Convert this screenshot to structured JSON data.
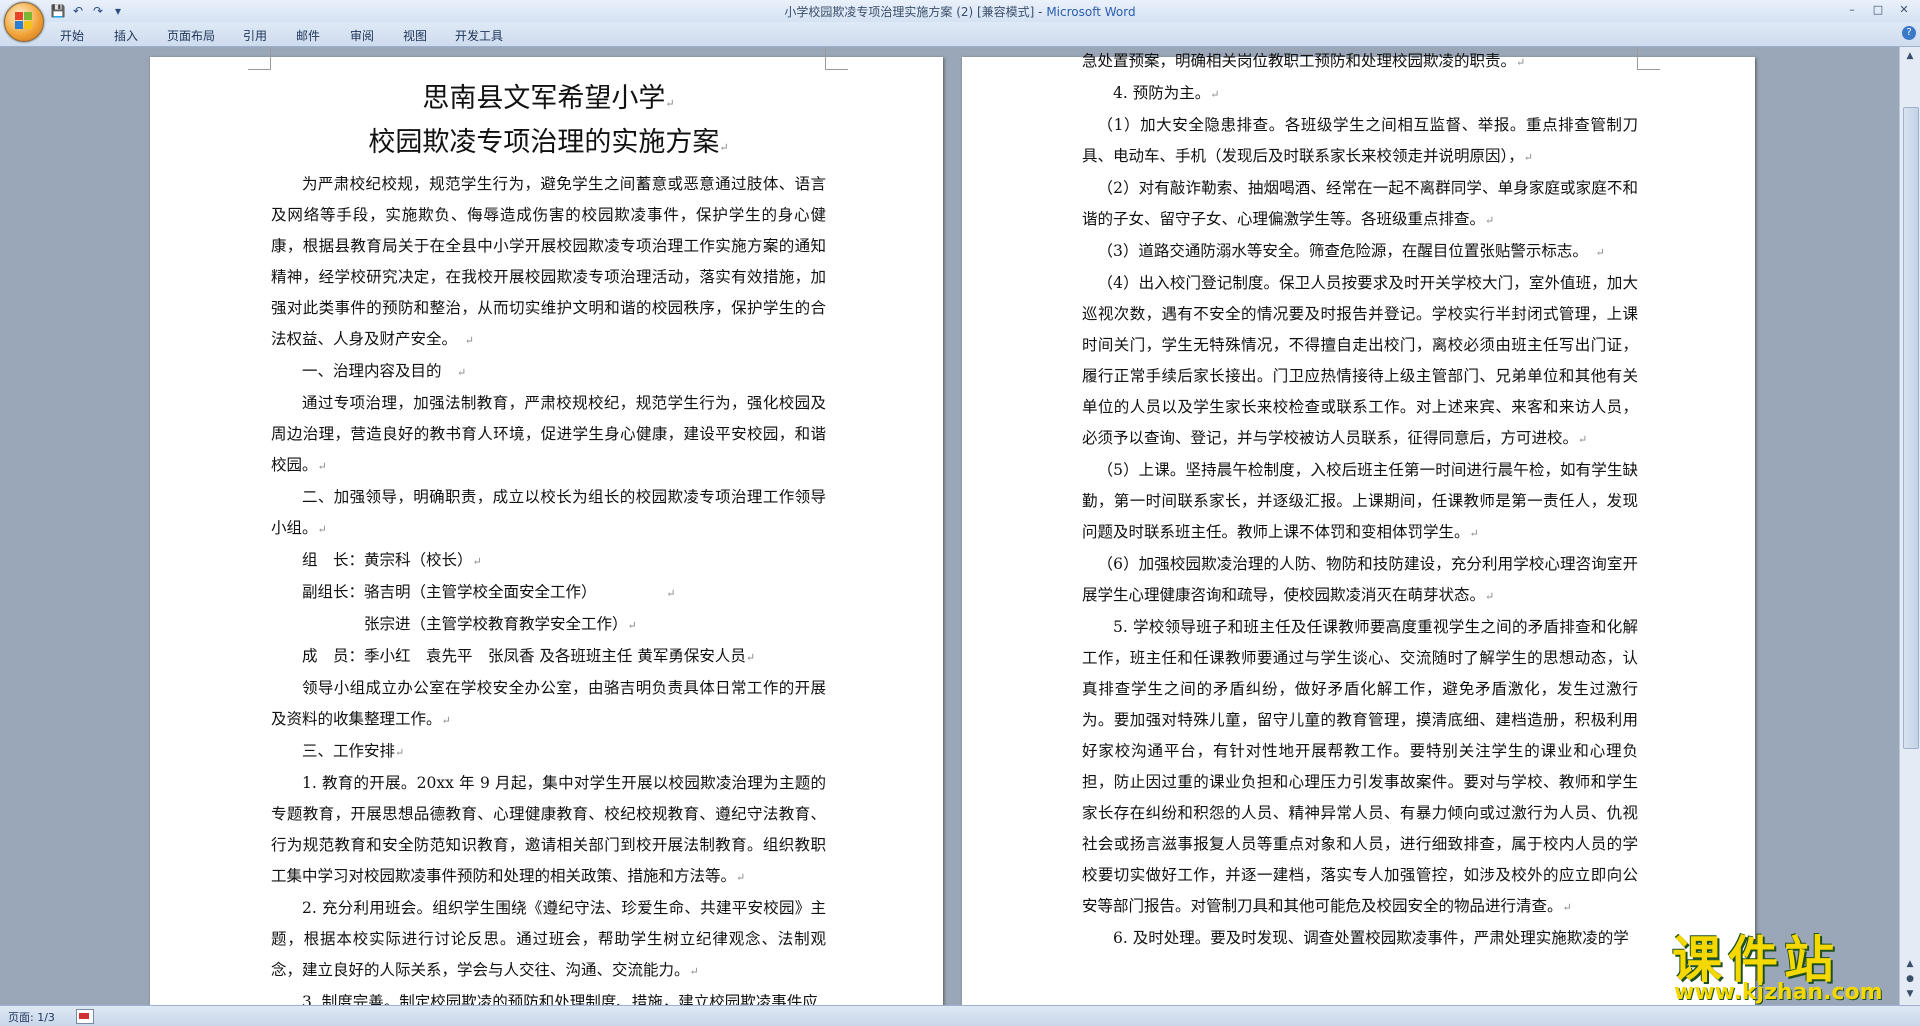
{
  "window": {
    "title": "小学校园欺凌专项治理实施方案 (2) [兼容模式] - ",
    "app": "Microsoft Word",
    "controls": [
      "–",
      "□",
      "✕"
    ]
  },
  "qat": {
    "save": "💾",
    "undo": "↶",
    "redo": "↷",
    "more": "▾"
  },
  "ribbon": {
    "tabs": [
      "开始",
      "插入",
      "页面布局",
      "引用",
      "邮件",
      "审阅",
      "视图",
      "开发工具"
    ],
    "help": "?"
  },
  "doc": {
    "page1": {
      "title1": "思南县文军希望小学",
      "title2": "校园欺凌专项治理的实施方案",
      "para1": "为严肃校纪校规，规范学生行为，避免学生之间蓄意或恶意通过肢体、语言及网络等手段，实施欺负、侮辱造成伤害的校园欺凌事件，保护学生的身心健康，根据县教育局关于在全县中小学开展校园欺凌专项治理工作实施方案的通知精神，经学校研究决定，在我校开展校园欺凌专项治理活动，落实有效措施，加强对此类事件的预防和整治，从而切实维护文明和谐的校园秩序，保护学生的合法权益、人身及财产安全。",
      "h1": "一、治理内容及目的",
      "para2": "通过专项治理，加强法制教育，严肃校规校纪，规范学生行为，强化校园及周边治理，营造良好的教书育人环境，促进学生身心健康，建设平安校园，和谐校园。",
      "h2": "二、加强领导，明确职责，成立以校长为组长的校园欺凌专项治理工作领导小组。",
      "leader": "组　长：黄宗科（校长）",
      "deputy1": "副组长：骆吉明（主管学校全面安全工作）",
      "deputy2": "张宗进（主管学校教育教学安全工作）",
      "members": "成　员：季小红　袁先平　张凤香 及各班班主任 黄军勇保安人员",
      "office": "领导小组成立办公室在学校安全办公室，由骆吉明负责具体日常工作的开展及资料的收集整理工作。",
      "h3": "三、工作安排",
      "item1": "1. 教育的开展。20xx 年 9 月起，集中对学生开展以校园欺凌治理为主题的专题教育，开展思想品德教育、心理健康教育、校纪校规教育、遵纪守法教育、行为规范教育和安全防范知识教育，邀请相关部门到校开展法制教育。组织教职工集中学习对校园欺凌事件预防和处理的相关政策、措施和方法等。",
      "item2": "2. 充分利用班会。组织学生围绕《遵纪守法、珍爱生命、共建平安校园》主题，根据本校实际进行讨论反思。通过班会，帮助学生树立纪律观念、法制观念，建立良好的人际关系，学会与人交往、沟通、交流能力。",
      "item3": "3. 制度完善。制定校园欺凌的预防和处理制度、措施，建立校园欺凌事件应"
    },
    "page2": {
      "cont": "急处置预案，明确相关岗位教职工预防和处理校园欺凌的职责。",
      "item4": "4. 预防为主。",
      "s1": "（1）加大安全隐患排查。各班级学生之间相互监督、举报。重点排查管制刀具、电动车、手机（发现后及时联系家长来校领走并说明原因），",
      "s2": "（2）对有敲诈勒索、抽烟喝酒、经常在一起不离群同学、单身家庭或家庭不和谐的子女、留守子女、心理偏激学生等。各班级重点排查。",
      "s3": "（3）道路交通防溺水等安全。筛查危险源，在醒目位置张贴警示标志。",
      "s4": "（4）出入校门登记制度。保卫人员按要求及时开关学校大门，室外值班，加大巡视次数，遇有不安全的情况要及时报告并登记。学校实行半封闭式管理，上课时间关门，学生无特殊情况，不得擅自走出校门，离校必须由班主任写出门证，履行正常手续后家长接出。门卫应热情接待上级主管部门、兄弟单位和其他有关单位的人员以及学生家长来校检查或联系工作。对上述来宾、来客和来访人员，必须予以查询、登记，并与学校被访人员联系，征得同意后，方可进校。",
      "s5": "（5）上课。坚持晨午检制度，入校后班主任第一时间进行晨午检，如有学生缺勤，第一时间联系家长，并逐级汇报。上课期间，任课教师是第一责任人，发现问题及时联系班主任。教师上课不体罚和变相体罚学生。",
      "s6": "（6）加强校园欺凌治理的人防、物防和技防建设，充分利用学校心理咨询室开展学生心理健康咨询和疏导，使校园欺凌消灭在萌芽状态。",
      "item5": "5. 学校领导班子和班主任及任课教师要高度重视学生之间的矛盾排查和化解工作，班主任和任课教师要通过与学生谈心、交流随时了解学生的思想动态，认真排查学生之间的矛盾纠纷，做好矛盾化解工作，避免矛盾激化，发生过激行为。要加强对特殊儿童，留守儿童的教育管理，摸清底细、建档造册，积极利用好家校沟通平台，有针对性地开展帮教工作。要特别关注学生的课业和心理负担，防止因过重的课业负担和心理压力引发事故案件。要对与学校、教师和学生家长存在纠纷和积怨的人员、精神异常人员、有暴力倾向或过激行为人员、仇视社会或扬言滋事报复人员等重点对象和人员，进行细致排查，属于校内人员的学校要切实做好工作，并逐一建档，落实专人加强管控，如涉及校外的应立即向公安等部门报告。对管制刀具和其他可能危及校园安全的物品进行清查。",
      "item6": "6. 及时处理。要及时发现、调查处置校园欺凌事件，严肃处理实施欺凌的学"
    },
    "para_mark": "↵"
  },
  "status": {
    "page": "页面: 1/3"
  },
  "watermark": {
    "title": "课件站",
    "url": "www.kjzhan.com"
  },
  "colors": {
    "workspace": "#9aa7b8",
    "ribbon": "#dfe9f6",
    "title_app": "#2a5db0",
    "watermark": "#f5d800"
  }
}
